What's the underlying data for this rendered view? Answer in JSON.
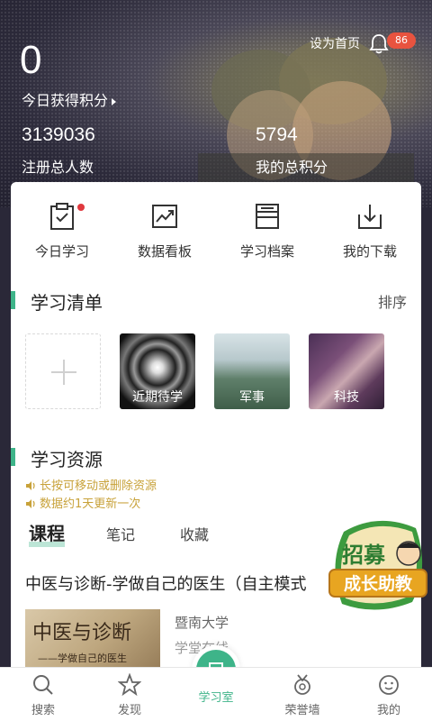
{
  "header": {
    "set_home": "设为首页",
    "notification_count": "86",
    "today_points": "0",
    "today_points_label": "今日获得积分",
    "total_users": "3139036",
    "total_users_label": "注册总人数",
    "my_points": "5794",
    "my_points_label": "我的总积分"
  },
  "quick_actions": [
    {
      "label": "今日学习",
      "icon": "clipboard-check-icon"
    },
    {
      "label": "数据看板",
      "icon": "trend-chart-icon"
    },
    {
      "label": "学习档案",
      "icon": "archive-icon"
    },
    {
      "label": "我的下载",
      "icon": "download-icon"
    }
  ],
  "study_list": {
    "title": "学习清单",
    "sort": "排序",
    "tiles": [
      {
        "caption": "近期待学"
      },
      {
        "caption": "军事"
      },
      {
        "caption": "科技"
      }
    ]
  },
  "resources": {
    "title": "学习资源",
    "hints": [
      "长按可移动或删除资源",
      "数据约1天更新一次"
    ]
  },
  "tabs": [
    {
      "label": "课程",
      "active": true
    },
    {
      "label": "笔记",
      "active": false
    },
    {
      "label": "收藏",
      "active": false
    }
  ],
  "course": {
    "title": "中医与诊断-学做自己的医生（自主模式",
    "thumb_title": "中医与诊断",
    "thumb_subtitle": "——学做自己的医生",
    "school": "暨南大学",
    "platform": "学堂在线"
  },
  "promo": {
    "line1": "招募",
    "line2": "成长助教"
  },
  "bottom_nav": [
    {
      "label": "搜索",
      "icon": "search-icon",
      "active": false
    },
    {
      "label": "发现",
      "icon": "star-icon",
      "active": false
    },
    {
      "label": "学习室",
      "icon": "door-icon",
      "active": true
    },
    {
      "label": "荣誉墙",
      "icon": "medal-icon",
      "active": false
    },
    {
      "label": "我的",
      "icon": "profile-icon",
      "active": false
    }
  ],
  "colors": {
    "accent": "#3eb489",
    "hint": "#c8a23a",
    "badge": "#e8533f"
  }
}
